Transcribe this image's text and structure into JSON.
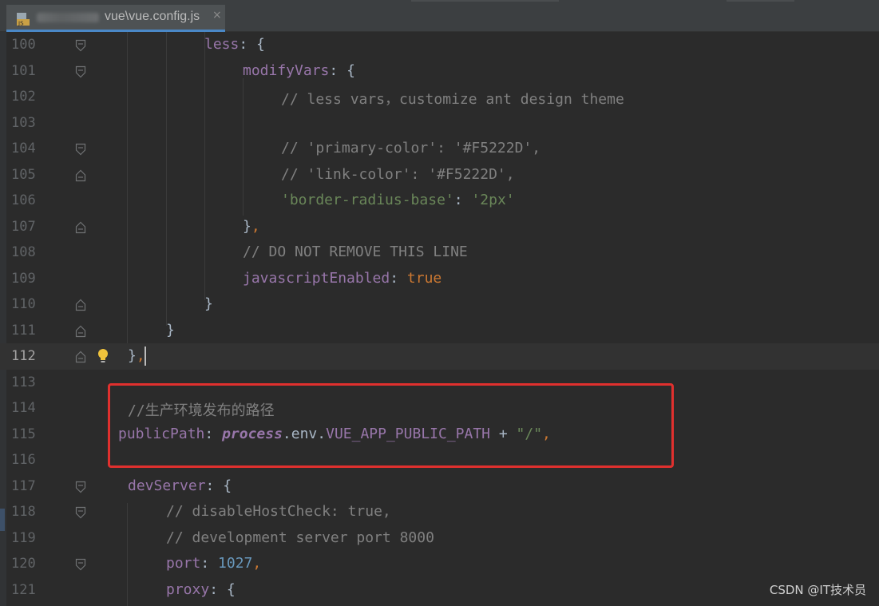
{
  "tab": {
    "title": "vue\\vue.config.js",
    "close": "×",
    "icon": "javascript-file-icon"
  },
  "watermark": "CSDN @IT技术员",
  "colors": {
    "background": "#2b2b2b",
    "keyword": "#cc7832",
    "property": "#9876aa",
    "string": "#6a8759",
    "number": "#6897bb",
    "comment": "#808080",
    "highlight_box": "#e0302e"
  },
  "lines": [
    {
      "num": "100",
      "tokens": [
        {
          "t": "less",
          "c": "key"
        },
        {
          "t": ": ",
          "c": "plain"
        },
        {
          "t": "{",
          "c": "brace"
        }
      ]
    },
    {
      "num": "101",
      "tokens": [
        {
          "t": "modifyVars",
          "c": "key"
        },
        {
          "t": ": ",
          "c": "plain"
        },
        {
          "t": "{",
          "c": "brace"
        }
      ]
    },
    {
      "num": "102",
      "tokens": [
        {
          "t": "// less vars，customize ant design theme",
          "c": "comment"
        }
      ]
    },
    {
      "num": "103",
      "tokens": []
    },
    {
      "num": "104",
      "tokens": [
        {
          "t": "// 'primary-color': '#F5222D',",
          "c": "comment"
        }
      ]
    },
    {
      "num": "105",
      "tokens": [
        {
          "t": "// 'link-color': '#F5222D',",
          "c": "comment"
        }
      ]
    },
    {
      "num": "106",
      "tokens": [
        {
          "t": "'border-radius-base'",
          "c": "str"
        },
        {
          "t": ": ",
          "c": "plain"
        },
        {
          "t": "'2px'",
          "c": "str"
        }
      ]
    },
    {
      "num": "107",
      "tokens": [
        {
          "t": "}",
          "c": "brace"
        },
        {
          "t": ",",
          "c": "punc"
        }
      ]
    },
    {
      "num": "108",
      "tokens": [
        {
          "t": "// DO NOT REMOVE THIS LINE",
          "c": "comment"
        }
      ]
    },
    {
      "num": "109",
      "tokens": [
        {
          "t": "javascriptEnabled",
          "c": "key"
        },
        {
          "t": ": ",
          "c": "plain"
        },
        {
          "t": "true",
          "c": "bool"
        }
      ]
    },
    {
      "num": "110",
      "tokens": [
        {
          "t": "}",
          "c": "brace"
        }
      ]
    },
    {
      "num": "111",
      "tokens": [
        {
          "t": "}",
          "c": "brace"
        }
      ]
    },
    {
      "num": "112",
      "tokens": [
        {
          "t": "}",
          "c": "brace"
        },
        {
          "t": ",",
          "c": "punc"
        }
      ]
    },
    {
      "num": "113",
      "tokens": []
    },
    {
      "num": "114",
      "tokens": [
        {
          "t": "//",
          "c": "comment"
        },
        {
          "t": "生产环境发布的路径",
          "c": "cn"
        }
      ]
    },
    {
      "num": "115",
      "tokens": [
        {
          "t": "publicPath",
          "c": "key"
        },
        {
          "t": ": ",
          "c": "plain"
        },
        {
          "t": "process",
          "c": "italic"
        },
        {
          "t": ".env.",
          "c": "plain"
        },
        {
          "t": "VUE_APP_PUBLIC_PATH",
          "c": "const"
        },
        {
          "t": " + ",
          "c": "plain"
        },
        {
          "t": "\"/\"",
          "c": "str"
        },
        {
          "t": ",",
          "c": "punc"
        }
      ]
    },
    {
      "num": "116",
      "tokens": []
    },
    {
      "num": "117",
      "tokens": [
        {
          "t": "devServer",
          "c": "key"
        },
        {
          "t": ": ",
          "c": "plain"
        },
        {
          "t": "{",
          "c": "brace"
        }
      ]
    },
    {
      "num": "118",
      "tokens": [
        {
          "t": "// disableHostCheck: true,",
          "c": "comment"
        }
      ]
    },
    {
      "num": "119",
      "tokens": [
        {
          "t": "// development server port 8000",
          "c": "comment"
        }
      ]
    },
    {
      "num": "120",
      "tokens": [
        {
          "t": "port",
          "c": "key"
        },
        {
          "t": ": ",
          "c": "plain"
        },
        {
          "t": "1027",
          "c": "num"
        },
        {
          "t": ",",
          "c": "punc"
        }
      ]
    },
    {
      "num": "121",
      "tokens": [
        {
          "t": "proxy",
          "c": "key"
        },
        {
          "t": ": ",
          "c": "plain"
        },
        {
          "t": "{",
          "c": "brace"
        }
      ]
    }
  ]
}
